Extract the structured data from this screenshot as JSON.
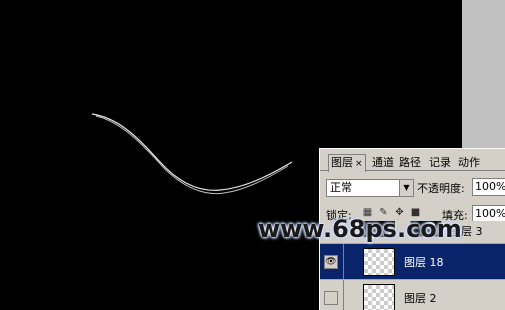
{
  "panel": {
    "tabs": [
      {
        "label": "图层",
        "close": "×",
        "active": true
      },
      {
        "label": "通道"
      },
      {
        "label": "路径"
      },
      {
        "label": "记录"
      },
      {
        "label": "动作"
      }
    ],
    "blend_mode": "正常",
    "opacity_label": "不透明度:",
    "opacity_value": "100%",
    "lock_label": "锁定:",
    "fill_label": "填充:",
    "fill_value": "100%",
    "layers": [
      {
        "name": "图层 3",
        "partial": true
      },
      {
        "name": "图层 18",
        "selected": true,
        "visible": true
      },
      {
        "name": "图层 2",
        "selected": false,
        "visible": false
      }
    ]
  },
  "icons": {
    "lock_transparent": "checkerboard-lock-icon",
    "lock_image": "brush-icon",
    "lock_position": "move-icon",
    "lock_all": "lock-icon",
    "visibility": "eye-icon"
  },
  "watermark": "www.68ps.com",
  "colors": {
    "canvas": "#000000",
    "stroke": "#ffffff",
    "panel": "#d4d0c8",
    "selected_row": "#0a246a"
  }
}
